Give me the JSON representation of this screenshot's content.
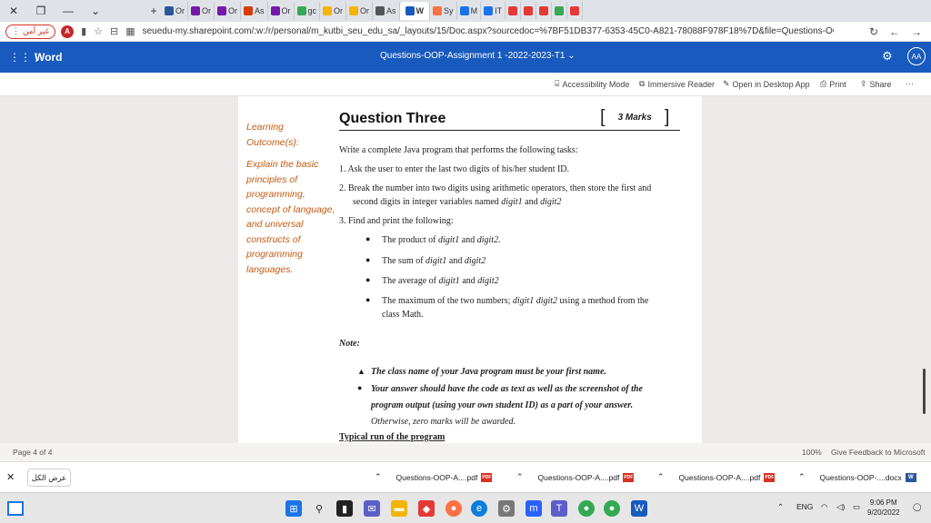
{
  "browser": {
    "tab_labels": [
      "Or",
      "Or",
      "Or",
      "As",
      "Or",
      "gc",
      "Or",
      "Or",
      "As",
      "Sy",
      "M",
      "IT"
    ],
    "active_tab_label": "W",
    "not_secure_label": "غير آمن",
    "profile_initial": "A",
    "url": "seuedu-my.sharepoint.com/:w:/r/personal/m_kutbi_seu_edu_sa/_layouts/15/Doc.aspx?sourcedoc=%7BF51DB377-6353-45C0-A821-78088F978F18%7D&file=Questions-OOP-Assignm..."
  },
  "word": {
    "app_name": "Word",
    "doc_title": "Questions-OOP-Assignment 1 -2022-2023-T1",
    "avatar": "AA"
  },
  "commands": {
    "accessibility": "Accessibility Mode",
    "immersive": "Immersive Reader",
    "open_desktop": "Open in Desktop App",
    "print": "Print",
    "share": "Share",
    "more": "···"
  },
  "doc": {
    "outcome_label": "Learning Outcome(s):",
    "outcome_text": "Explain the basic principles of programming, concept of language, and universal constructs of programming languages.",
    "question_title": "Question Three",
    "marks": "3 Marks",
    "intro": "Write a complete Java program that performs the following tasks:",
    "step1": "1.  Ask the user to enter the last two digits of his/her student ID.",
    "step2_a": "2.  Break the number into two digits using arithmetic operators, then store the first and",
    "step2_b": "second digits in integer variables named ",
    "step2_v1": "digit1",
    "step2_and": " and ",
    "step2_v2": "digit2",
    "step3": "3.  Find and print the following:",
    "sub1_a": "The product of ",
    "sub1_v1": "digit1",
    "sub1_and": " and ",
    "sub1_v2": "digit2.",
    "sub2_a": "The sum of ",
    "sub2_v1": "digit1",
    "sub2_and": " and ",
    "sub2_v2": "digit2",
    "sub3_a": "The average of ",
    "sub3_v1": "digit1",
    "sub3_and": " and ",
    "sub3_v2": "digit2",
    "sub4_a": "The maximum of the two numbers; ",
    "sub4_v": "digit1 digit2",
    "sub4_b": " using a method from the",
    "sub4_c": "class Math.",
    "note_label": "Note:",
    "note1": "The class name of your Java program must be your first name.",
    "note2_a": "Your answer should have the code as text as well as the screenshot of the",
    "note2_b": "program output (using your own student ID) as a part of your answer.",
    "note2_c": "Otherwise, zero marks will be awarded.",
    "typical_run": "Typical run of the program"
  },
  "status": {
    "page": "Page 4 of 4",
    "zoom": "100%",
    "feedback": "Give Feedback to Microsoft"
  },
  "downloads": {
    "show_all": "عرض الكل",
    "items": [
      "Questions-OOP-A....pdf",
      "Questions-OOP-A....pdf",
      "Questions-OOP-A....pdf",
      "Questions-OOP-....docx"
    ]
  },
  "taskbar": {
    "lang": "ENG",
    "time": "9:06 PM",
    "date": "9/20/2022"
  }
}
